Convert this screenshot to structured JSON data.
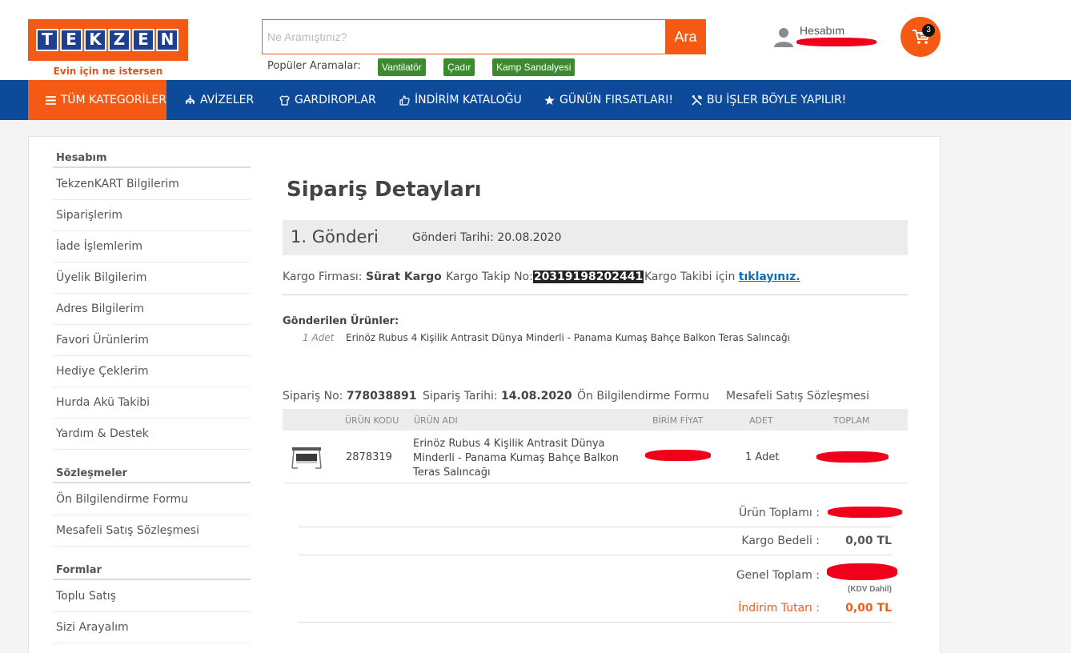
{
  "header": {
    "logo_letters": [
      "T",
      "E",
      "K",
      "Z",
      "E",
      "N"
    ],
    "logo_text": "TEKZEN",
    "tagline": "Evin için ne istersen",
    "search_placeholder": "Ne Aramıştınız?",
    "search_button": "Ara",
    "popular_label": "Popüler Aramalar:",
    "popular_tags": [
      "Vantilatör",
      "Çadır",
      "Kamp Sandalyesi"
    ],
    "account_label": "Hesabım",
    "cart_count": "3"
  },
  "nav": {
    "items": [
      {
        "label": "TÜM KATEGORİLER",
        "icon": "menu-icon"
      },
      {
        "label": "AVİZELER",
        "icon": "chandelier-icon"
      },
      {
        "label": "GARDIROPLAR",
        "icon": "shirt-icon"
      },
      {
        "label": "İNDİRİM KATALOĞU",
        "icon": "thumbs-up-icon"
      },
      {
        "label": "GÜNÜN FIRSATLARI!",
        "icon": "star-icon"
      },
      {
        "label": "BU İŞLER BÖYLE YAPILIR!",
        "icon": "tools-icon"
      }
    ]
  },
  "sidebar": {
    "sections": [
      {
        "title": "Hesabım",
        "items": [
          "TekzenKART Bilgilerim",
          "Siparişlerim",
          "İade İşlemlerim",
          "Üyelik Bilgilerim",
          "Adres Bilgilerim",
          "Favori Ürünlerim",
          "Hediye Çeklerim",
          "Hurda Akü Takibi",
          "Yardım & Destek"
        ]
      },
      {
        "title": "Sözleşmeler",
        "items": [
          "Ön Bilgilendirme Formu",
          "Mesafeli Satış Sözleşmesi"
        ]
      },
      {
        "title": "Formlar",
        "items": [
          "Toplu Satış",
          "Sizi Arayalım"
        ]
      }
    ]
  },
  "order": {
    "page_title": "Sipariş Detayları",
    "shipment_title": "1. Gönderi",
    "shipment_date_label": "Gönderi Tarihi:",
    "shipment_date": "20.08.2020",
    "cargo_company_label": "Kargo Firması:",
    "cargo_company": "Sürat Kargo",
    "tracking_label": "Kargo Takip No:",
    "tracking_no": "20319198202441",
    "tracking_link_prefix": "Kargo Takibi için",
    "tracking_link": "tıklayınız.",
    "sent_products_label": "Gönderilen Ürünler:",
    "sent_products": [
      {
        "qty": "1 Adet",
        "name": "Erinöz Rubus 4 Kişilik Antrasit Dünya Minderli - Panama Kumaş Bahçe Balkon Teras Salıncağı"
      }
    ],
    "order_no_label": "Sipariş No:",
    "order_no": "778038891",
    "order_date_label": "Sipariş Tarihi:",
    "order_date": "14.08.2020",
    "info_form_link": "Ön Bilgilendirme Formu",
    "contract_link": "Mesafeli Satış Sözleşmesi",
    "table": {
      "columns": [
        "ÜRÜN KODU",
        "ÜRÜN ADI",
        "BİRİM FİYAT",
        "ADET",
        "TOPLAM"
      ],
      "rows": [
        {
          "code": "2878319",
          "name_lines": [
            "Erinöz Rubus 4 Kişilik Antrasit Dünya",
            "Minderli - Panama Kumaş Bahçe Balkon",
            "Teras Salıncağı"
          ],
          "qty": "1 Adet"
        }
      ]
    },
    "summary": {
      "product_total_label": "Ürün Toplamı :",
      "shipping_label": "Kargo Bedeli :",
      "shipping_value": "0,00 TL",
      "grand_total_label": "Genel Toplam :",
      "kdv_note": "(KDV Dahil)",
      "discount_label": "İndirim Tutarı :",
      "discount_value": "0,00 TL"
    }
  },
  "colors": {
    "brand_orange": "#f45a14",
    "nav_blue": "#0d4b9a",
    "tag_green": "#3c8a2e",
    "link_blue": "#136cb2",
    "redaction_red": "#f0001a"
  }
}
